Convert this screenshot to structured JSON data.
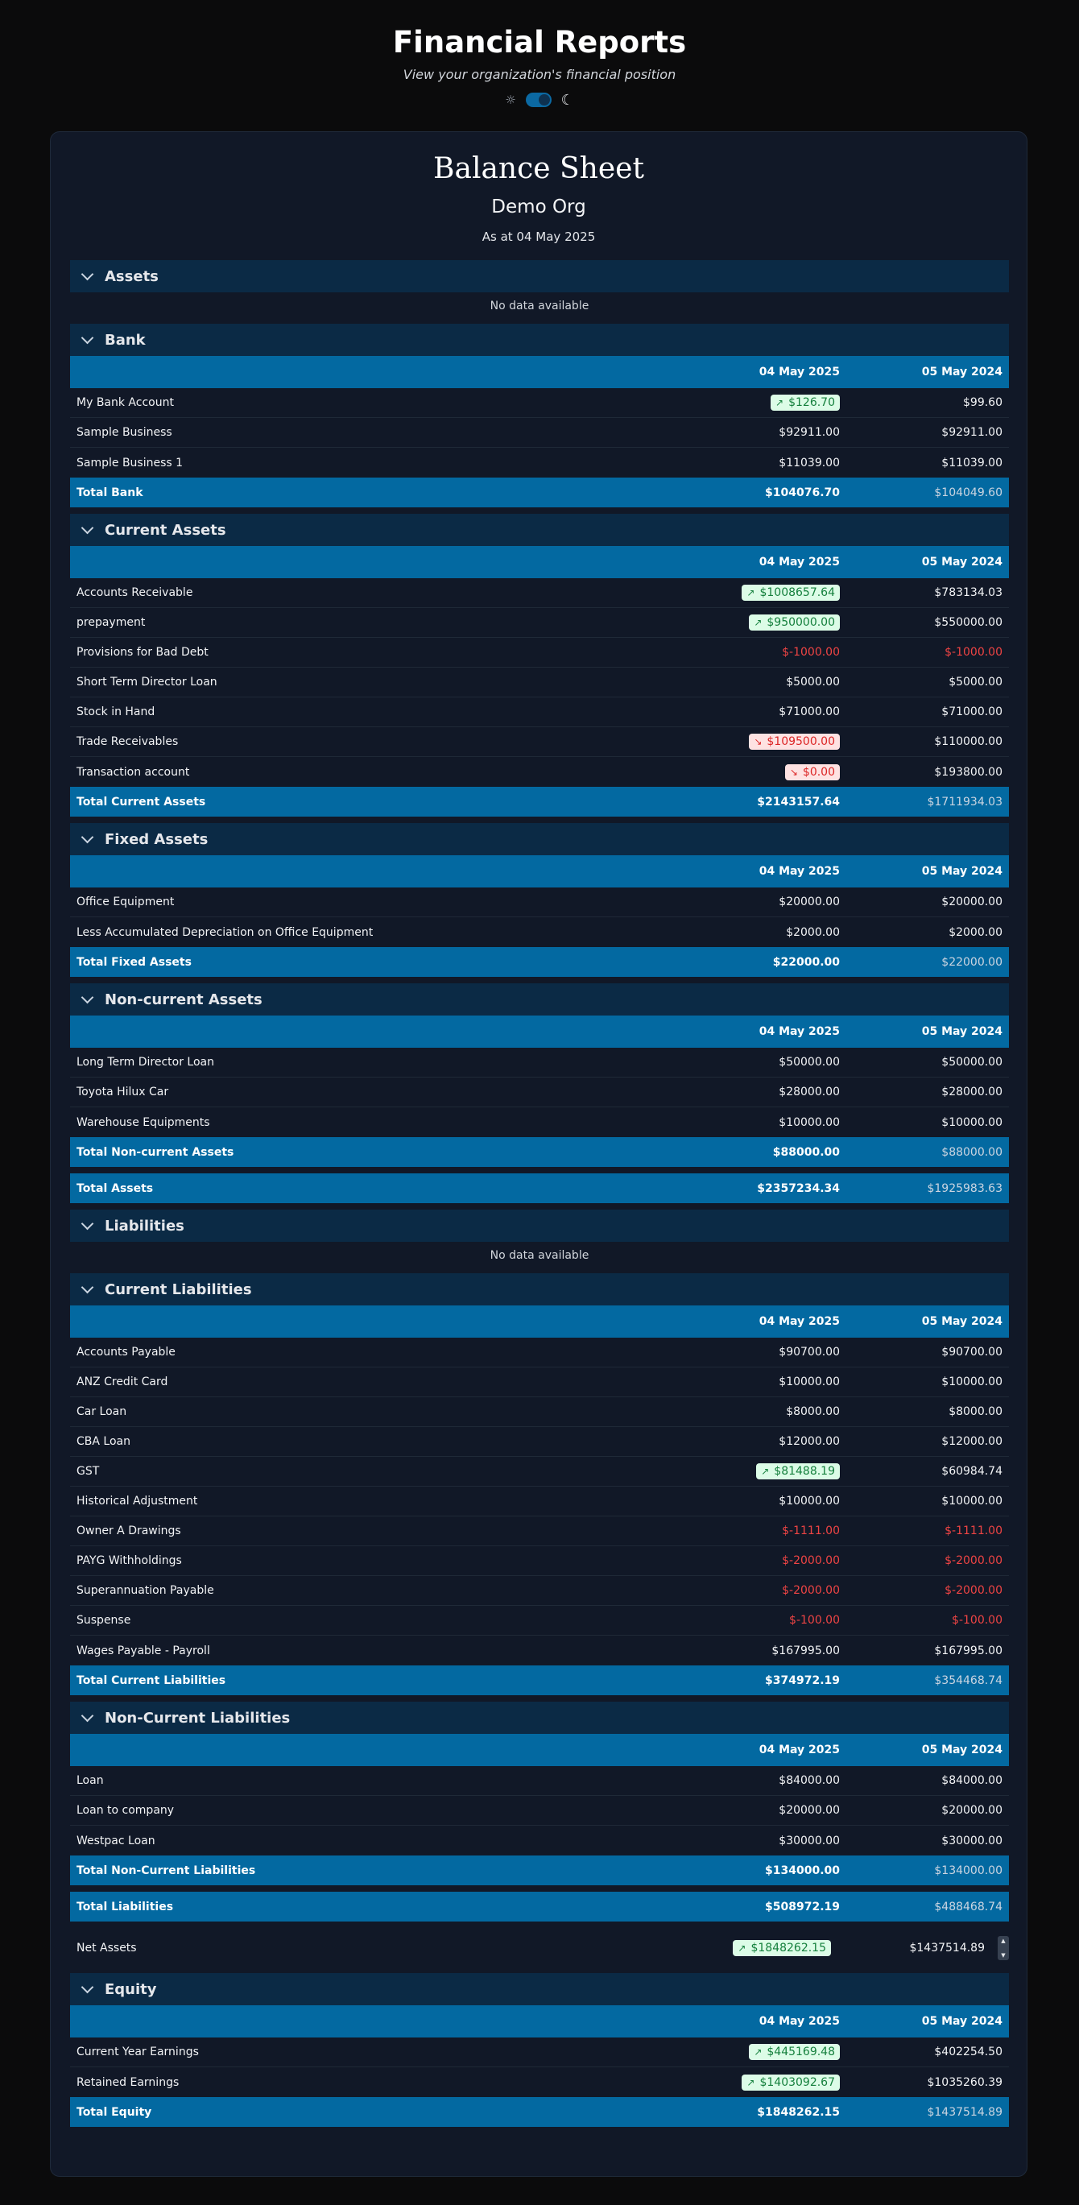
{
  "header": {
    "title": "Financial Reports",
    "subtitle": "View your organization's financial position",
    "sun_icon": "sun-icon",
    "moon_icon": "moon-icon",
    "toggle_color": "#0369a1"
  },
  "report": {
    "title": "Balance Sheet",
    "org": "Demo Org",
    "as_at": "As at 04 May 2025",
    "col_current": "04 May 2025",
    "col_previous": "05 May 2024"
  },
  "sections": {
    "assets": {
      "title": "Assets",
      "no_data": "No data available"
    },
    "bank": {
      "title": "Bank",
      "rows": [
        {
          "label": "My Bank Account",
          "current": "$126.70",
          "previous": "$99.60"
        },
        {
          "label": "Sample Business",
          "current": "$92911.00",
          "previous": "$92911.00"
        },
        {
          "label": "Sample Business 1",
          "current": "$11039.00",
          "previous": "$11039.00"
        }
      ],
      "total": {
        "label": "Total Bank",
        "current": "$104076.70",
        "previous": "$104049.60"
      }
    },
    "current_assets": {
      "title": "Current Assets",
      "rows": [
        {
          "label": "Accounts Receivable",
          "current": "$1008657.64",
          "previous": "$783134.03"
        },
        {
          "label": "prepayment",
          "current": "$950000.00",
          "previous": "$550000.00"
        },
        {
          "label": "Provisions for Bad Debt",
          "current": "$-1000.00",
          "previous": "$-1000.00"
        },
        {
          "label": "Short Term Director Loan",
          "current": "$5000.00",
          "previous": "$5000.00"
        },
        {
          "label": "Stock in Hand",
          "current": "$71000.00",
          "previous": "$71000.00"
        },
        {
          "label": "Trade Receivables",
          "current": "$109500.00",
          "previous": "$110000.00"
        },
        {
          "label": "Transaction account",
          "current": "$0.00",
          "previous": "$193800.00"
        }
      ],
      "total": {
        "label": "Total Current Assets",
        "current": "$2143157.64",
        "previous": "$1711934.03"
      }
    },
    "fixed_assets": {
      "title": "Fixed Assets",
      "rows": [
        {
          "label": "Office Equipment",
          "current": "$20000.00",
          "previous": "$20000.00"
        },
        {
          "label": "Less Accumulated Depreciation on Office Equipment",
          "current": "$2000.00",
          "previous": "$2000.00"
        }
      ],
      "total": {
        "label": "Total Fixed Assets",
        "current": "$22000.00",
        "previous": "$22000.00"
      }
    },
    "non_current_assets": {
      "title": "Non-current Assets",
      "rows": [
        {
          "label": "Long Term Director Loan",
          "current": "$50000.00",
          "previous": "$50000.00"
        },
        {
          "label": "Toyota Hilux Car",
          "current": "$28000.00",
          "previous": "$28000.00"
        },
        {
          "label": "Warehouse Equipments",
          "current": "$10000.00",
          "previous": "$10000.00"
        }
      ],
      "total": {
        "label": "Total Non-current Assets",
        "current": "$88000.00",
        "previous": "$88000.00"
      }
    },
    "total_assets": {
      "label": "Total Assets",
      "current": "$2357234.34",
      "previous": "$1925983.63"
    },
    "liabilities": {
      "title": "Liabilities",
      "no_data": "No data available"
    },
    "current_liabilities": {
      "title": "Current Liabilities",
      "rows": [
        {
          "label": "Accounts Payable",
          "current": "$90700.00",
          "previous": "$90700.00"
        },
        {
          "label": "ANZ Credit Card",
          "current": "$10000.00",
          "previous": "$10000.00"
        },
        {
          "label": "Car Loan",
          "current": "$8000.00",
          "previous": "$8000.00"
        },
        {
          "label": "CBA Loan",
          "current": "$12000.00",
          "previous": "$12000.00"
        },
        {
          "label": "GST",
          "current": "$81488.19",
          "previous": "$60984.74"
        },
        {
          "label": "Historical Adjustment",
          "current": "$10000.00",
          "previous": "$10000.00"
        },
        {
          "label": "Owner A Drawings",
          "current": "$-1111.00",
          "previous": "$-1111.00"
        },
        {
          "label": "PAYG Withholdings",
          "current": "$-2000.00",
          "previous": "$-2000.00"
        },
        {
          "label": "Superannuation Payable",
          "current": "$-2000.00",
          "previous": "$-2000.00"
        },
        {
          "label": "Suspense",
          "current": "$-100.00",
          "previous": "$-100.00"
        },
        {
          "label": "Wages Payable - Payroll",
          "current": "$167995.00",
          "previous": "$167995.00"
        }
      ],
      "total": {
        "label": "Total Current Liabilities",
        "current": "$374972.19",
        "previous": "$354468.74"
      }
    },
    "non_current_liabilities": {
      "title": "Non-Current Liabilities",
      "rows": [
        {
          "label": "Loan",
          "current": "$84000.00",
          "previous": "$84000.00"
        },
        {
          "label": "Loan to company",
          "current": "$20000.00",
          "previous": "$20000.00"
        },
        {
          "label": "Westpac Loan",
          "current": "$30000.00",
          "previous": "$30000.00"
        }
      ],
      "total": {
        "label": "Total Non-Current Liabilities",
        "current": "$134000.00",
        "previous": "$134000.00"
      }
    },
    "total_liabilities": {
      "label": "Total Liabilities",
      "current": "$508972.19",
      "previous": "$488468.74"
    },
    "net_assets": {
      "label": "Net Assets",
      "current": "$1848262.15",
      "previous": "$1437514.89"
    },
    "equity": {
      "title": "Equity",
      "rows": [
        {
          "label": "Current Year Earnings",
          "current": "$445169.48",
          "previous": "$402254.50"
        },
        {
          "label": "Retained Earnings",
          "current": "$1403092.67",
          "previous": "$1035260.39"
        }
      ],
      "total": {
        "label": "Total Equity",
        "current": "$1848262.15",
        "previous": "$1437514.89"
      }
    }
  }
}
